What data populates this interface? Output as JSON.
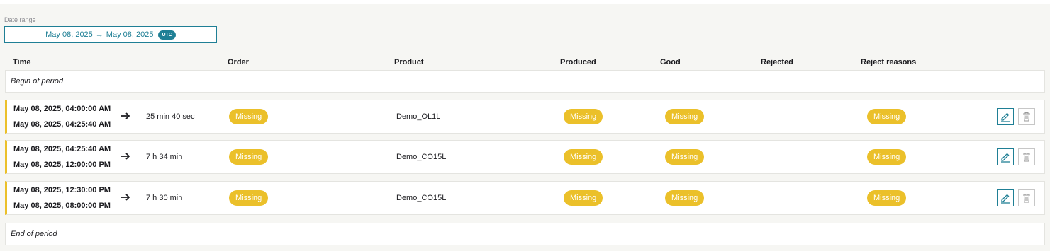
{
  "date_range": {
    "label": "Date range",
    "start": "May 08, 2025",
    "arrow": "→",
    "end": "May 08, 2025",
    "timezone": "UTC"
  },
  "columns": {
    "time": "Time",
    "order": "Order",
    "product": "Product",
    "produced": "Produced",
    "good": "Good",
    "rejected": "Rejected",
    "reject_reasons": "Reject reasons"
  },
  "begin_label": "Begin of period",
  "end_label": "End of period",
  "rows": [
    {
      "start": "May 08, 2025, 04:00:00 AM",
      "end": "May 08, 2025, 04:25:40 AM",
      "duration": "25 min 40 sec",
      "order": "Missing",
      "product": "Demo_OL1L",
      "produced": "Missing",
      "good": "Missing",
      "reject_reasons": "Missing"
    },
    {
      "start": "May 08, 2025, 04:25:40 AM",
      "end": "May 08, 2025, 12:00:00 PM",
      "duration": "7 h 34 min",
      "order": "Missing",
      "product": "Demo_CO15L",
      "produced": "Missing",
      "good": "Missing",
      "reject_reasons": "Missing"
    },
    {
      "start": "May 08, 2025, 12:30:00 PM",
      "end": "May 08, 2025, 08:00:00 PM",
      "duration": "7 h 30 min",
      "order": "Missing",
      "product": "Demo_CO15L",
      "produced": "Missing",
      "good": "Missing",
      "reject_reasons": "Missing"
    }
  ],
  "icons": {
    "edit": "pencil-icon",
    "delete": "trash-icon",
    "arrow": "arrow-right-icon"
  },
  "colors": {
    "accent": "#1f7f95",
    "status_missing": "#ebc02a",
    "row_marker": "#ebc02a"
  }
}
